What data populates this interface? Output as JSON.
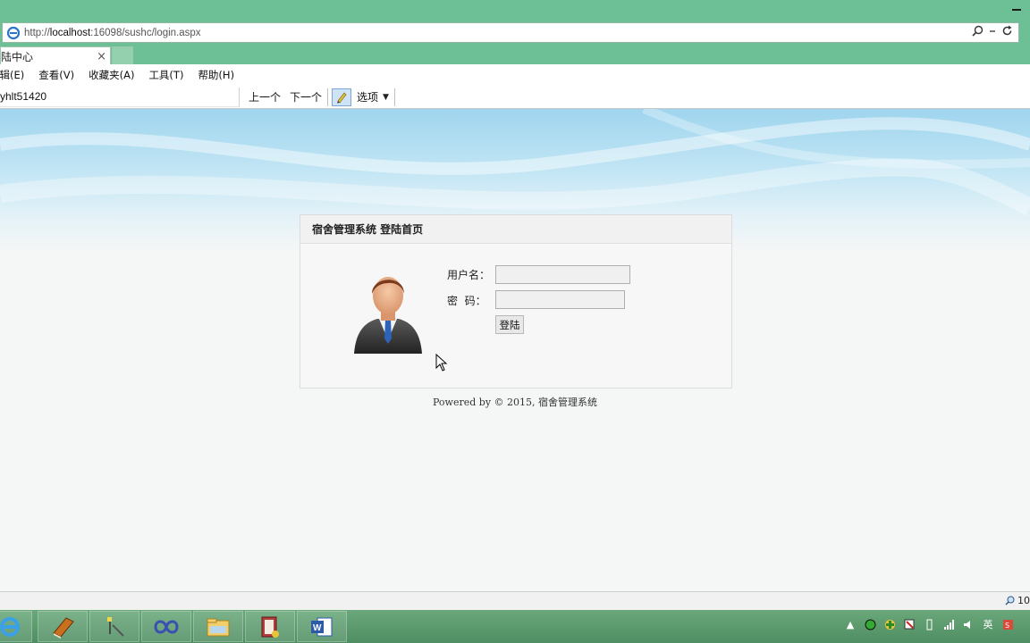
{
  "browser": {
    "url_prefix": "http://",
    "url_host": "localhost",
    "url_rest": ":16098/sushc/login.aspx",
    "tab_title": "陆中心",
    "tab_close": "×"
  },
  "menu": {
    "items": [
      "编辑(E)",
      "查看(V)",
      "收藏夹(A)",
      "工具(T)",
      "帮助(H)"
    ],
    "first_partial": "编辑(E)"
  },
  "findbar": {
    "query": "yhlt51420",
    "prev_label": "上一个",
    "next_label": "下一个",
    "options_label": "选项"
  },
  "login": {
    "header": "宿舍管理系统 登陆首页",
    "username_label": "用户名：",
    "password_label": "密  码：",
    "username_value": "",
    "password_value": "",
    "submit_label": "登陆"
  },
  "footer": {
    "text": "Powered by © 2015, 宿舍管理系统"
  },
  "statusbar": {
    "zoom": "10"
  },
  "taskbar": {
    "apps": [
      "ie-icon",
      "book-icon",
      "paint-icon",
      "visual-studio-icon",
      "file-explorer-icon",
      "notes-icon",
      "word-icon"
    ],
    "ime": "英"
  },
  "colors": {
    "frame": "#6dc096",
    "taskbar": "#4f8e62",
    "sky": "#9fd5ee"
  }
}
